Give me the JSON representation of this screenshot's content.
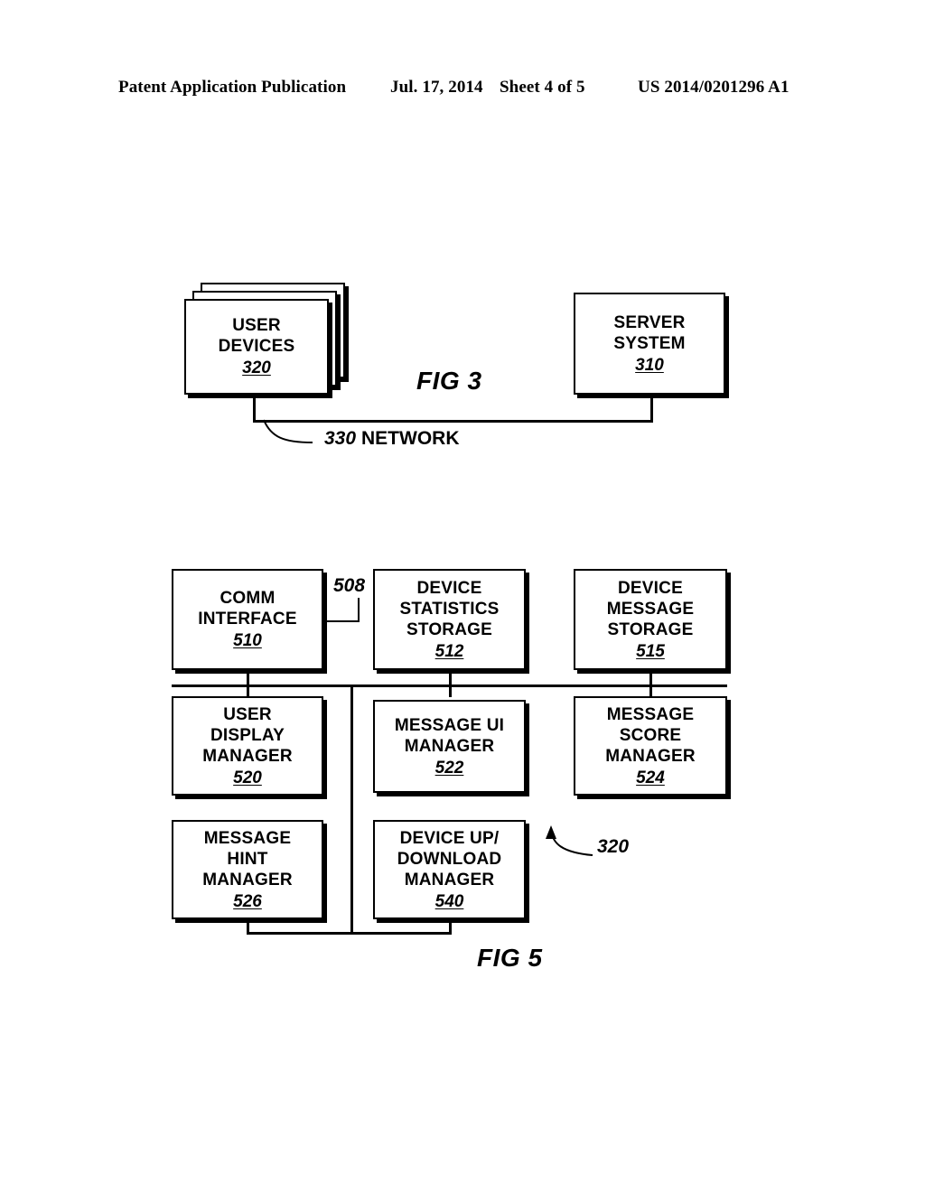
{
  "header": {
    "publication": "Patent Application Publication",
    "date": "Jul. 17, 2014",
    "sheet": "Sheet 4 of 5",
    "patent_number": "US 2014/0201296 A1"
  },
  "fig3": {
    "label": "FIG 3",
    "user_devices": {
      "line1": "USER",
      "line2": "DEVICES",
      "ref": "320"
    },
    "server_system": {
      "line1": "SERVER",
      "line2": "SYSTEM",
      "ref": "310"
    },
    "network": {
      "ref": "330",
      "label": "NETWORK"
    }
  },
  "fig5": {
    "label": "FIG 5",
    "bus_ref": "508",
    "device_ref": "320",
    "boxes": [
      {
        "lines": [
          "COMM",
          "INTERFACE"
        ],
        "ref": "510"
      },
      {
        "lines": [
          "DEVICE",
          "STATISTICS",
          "STORAGE"
        ],
        "ref": "512"
      },
      {
        "lines": [
          "DEVICE",
          "MESSAGE",
          "STORAGE"
        ],
        "ref": "515"
      },
      {
        "lines": [
          "USER",
          "DISPLAY",
          "MANAGER"
        ],
        "ref": "520"
      },
      {
        "lines": [
          "MESSAGE UI",
          "MANAGER"
        ],
        "ref": "522"
      },
      {
        "lines": [
          "MESSAGE",
          "SCORE",
          "MANAGER"
        ],
        "ref": "524"
      },
      {
        "lines": [
          "MESSAGE",
          "HINT",
          "MANAGER"
        ],
        "ref": "526"
      },
      {
        "lines": [
          "DEVICE UP/",
          "DOWNLOAD",
          "MANAGER"
        ],
        "ref": "540"
      }
    ]
  }
}
